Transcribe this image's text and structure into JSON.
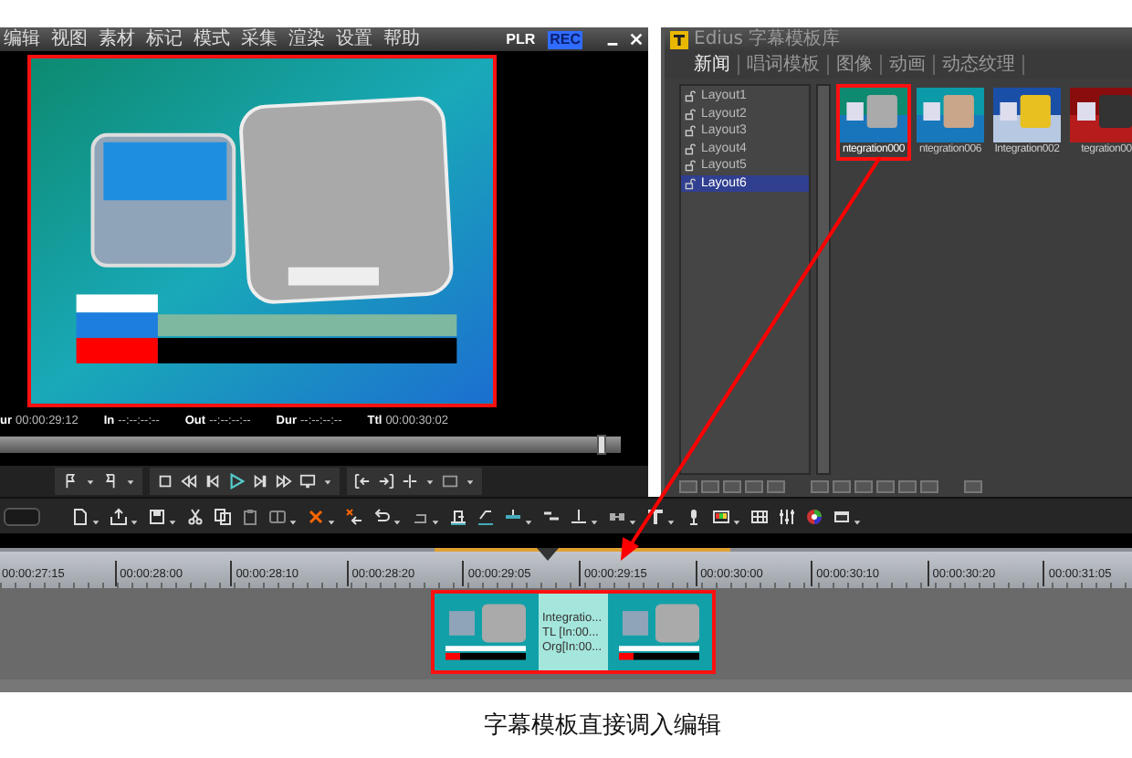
{
  "player": {
    "menu": [
      "编辑",
      "视图",
      "素材",
      "标记",
      "模式",
      "采集",
      "渲染",
      "设置",
      "帮助"
    ],
    "modes": [
      {
        "label": "PLR",
        "selected": false
      },
      {
        "label": "REC",
        "selected": true
      }
    ],
    "preview": {
      "highlighted": true
    },
    "timecodes": [
      {
        "label": "ur",
        "value": "00:00:29:12"
      },
      {
        "label": "In",
        "value": "--:--:--:--"
      },
      {
        "label": "Out",
        "value": "--:--:--:--"
      },
      {
        "label": "Dur",
        "value": "--:--:--:--"
      },
      {
        "label": "Ttl",
        "value": "00:00:30:02"
      }
    ],
    "scrubber": {
      "level": 0.97
    }
  },
  "library": {
    "title": "Edius 字幕模板库",
    "tabs": [
      {
        "label": "新闻",
        "selected": true
      },
      {
        "label": "唱词模板",
        "selected": false
      },
      {
        "label": "图像",
        "selected": false
      },
      {
        "label": "动画",
        "selected": false
      },
      {
        "label": "动态纹理",
        "selected": false
      }
    ],
    "layouts": [
      {
        "label": "Layout1",
        "selected": false
      },
      {
        "label": "Layout2",
        "selected": false
      },
      {
        "label": "Layout3",
        "selected": false
      },
      {
        "label": "Layout4",
        "selected": false
      },
      {
        "label": "Layout5",
        "selected": false
      },
      {
        "label": "Layout6",
        "selected": true
      }
    ],
    "templates": [
      {
        "label": "ntegration000",
        "selected": true
      },
      {
        "label": "ntegration006",
        "selected": false
      },
      {
        "label": "Integration002",
        "selected": false
      },
      {
        "label": "tegration00",
        "selected": false
      }
    ]
  },
  "timeline": {
    "ruler": [
      "00:00:27:15",
      "00:00:28:00",
      "00:00:28:10",
      "00:00:28:20",
      "00:00:29:05",
      "00:00:29:15",
      "00:00:30:00",
      "00:00:30:10",
      "00:00:30:20",
      "00:00:31:05"
    ],
    "clip": {
      "highlighted": true,
      "lines": [
        "Integratio...",
        "TL [In:00...",
        "Org[In:00..."
      ]
    }
  },
  "caption": "字幕模板直接调入编辑"
}
